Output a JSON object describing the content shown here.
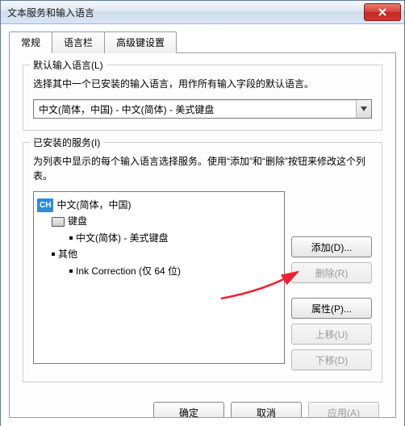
{
  "window": {
    "title": "文本服务和输入语言"
  },
  "tabs": {
    "general": "常规",
    "langbar": "语言栏",
    "advanced": "高级键设置"
  },
  "default_group": {
    "legend": "默认输入语言(L)",
    "desc": "选择其中一个已安装的输入语言，用作所有输入字段的默认语言。",
    "selected": "中文(简体，中国) - 中文(简体) - 美式键盘"
  },
  "installed_group": {
    "legend": "已安装的服务(I)",
    "desc": "为列表中显示的每个输入语言选择服务。使用“添加”和“删除”按钮来修改这个列表。",
    "tree": {
      "root_badge": "CH",
      "root_label": "中文(简体，中国)",
      "kb_label": "键盘",
      "kb_item": "中文(简体) - 美式键盘",
      "other_label": "其他",
      "other_item": "Ink Correction (仅 64 位)"
    }
  },
  "buttons": {
    "add": "添加(D)...",
    "remove": "删除(R)",
    "props": "属性(P)...",
    "up": "上移(U)",
    "down": "下移(D)"
  },
  "footer": {
    "ok": "确定",
    "cancel": "取消",
    "apply": "应用(A)"
  }
}
